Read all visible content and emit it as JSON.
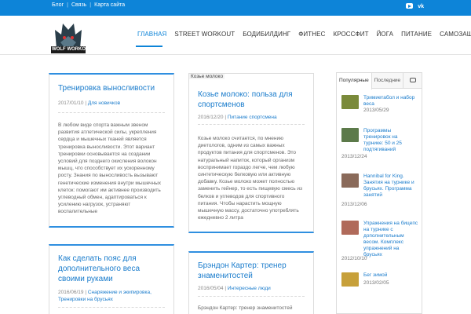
{
  "topbar": {
    "links": [
      "Блог",
      "Связь",
      "Карта сайта"
    ],
    "social": [
      "youtube-icon",
      "vk-icon"
    ],
    "vk_text": "vk"
  },
  "header": {
    "logo_text": "WOLF WORKOUT",
    "nav": [
      {
        "label": "ГЛАВНАЯ",
        "active": true
      },
      {
        "label": "STREET WORKOUT",
        "active": false
      },
      {
        "label": "БОДИБИЛДИНГ",
        "active": false
      },
      {
        "label": "ФИТНЕС",
        "active": false
      },
      {
        "label": "КРОССФИТ",
        "active": false
      },
      {
        "label": "ЙОГА",
        "active": false
      },
      {
        "label": "ПИТАНИЕ",
        "active": false
      },
      {
        "label": "САМОЗАЩИТА",
        "active": false
      }
    ]
  },
  "posts": [
    {
      "title": "Тренировка выносливости",
      "date": "2017/01/10",
      "category": "Для новичков",
      "excerpt": "В любом виде спорта важным звеном развития атлетической силы, укрепления сердца и мышечных тканей является тренировка выносливости. Этот вариант тренировки основывается на создании условий для позднего окисления волокон мышц, что способствует их ускоренному росту. Знания по выносливость вызывают генетические изменения внутри мышечных клеток: помогают им активнее производить углеводный обмен, адаптироваться к усилению нагрузок, устраняют воспалительные"
    },
    {
      "image_label": "Козье молоко",
      "title": "Козье молоко: польза для спортсменов",
      "date": "2016/12/20",
      "category": "Питание спортсмена",
      "excerpt": "Козье молоко считается, по мнению диетологов, одним из самых важных продуктов питания для спортсменов. Это натуральный напиток, который организм воспринимает гораздо легче, чем любую синтетическую белковую или активную добавку. Козье молоко может полностью заменить гейнер, то есть пищевую смесь из белков и углеводов для спортивного питания. Чтобы нарастить мощную мышечную массу, достаточно употреблять ежедневно 2 литра"
    },
    {
      "title": "Как сделать пояс для дополнительного веса своими руками",
      "date": "2016/06/19",
      "category": "Снаряжение и экипировка, Тренировки на брусьях"
    },
    {
      "title": "Брэндон Картер: тренер знаменитостей",
      "date": "2016/05/04",
      "category": "Интересные люди",
      "excerpt": "Брэндон Картер: тренер знаменитостей"
    }
  ],
  "sidebar": {
    "tabs": [
      "Популярные",
      "Последние"
    ],
    "comments_tab_icon": "comment-icon",
    "items": [
      {
        "title": "Тримиетабол и набор веса",
        "date": "2013/05/29",
        "thumb_color": "#7a8a3a"
      },
      {
        "title": "Программы тренировок на турнике: 50 и 25 подтягиваний",
        "date": "2013/12/24",
        "thumb_color": "#5c7a4a"
      },
      {
        "title": "Hannibal for King. Занятия на турнике и брусьях. Программа занятий",
        "date": "2013/12/06",
        "thumb_color": "#8a6a5a"
      },
      {
        "title": "Упражнения на бицепс на турнике с дополнительным весом. Комплекс упражнений на брусьях",
        "date": "2012/10/10",
        "thumb_color": "#b06a5a"
      },
      {
        "title": "Бег зимой",
        "date": "2013/02/05",
        "thumb_color": "#c7a03a"
      }
    ]
  },
  "colors": {
    "accent": "#0d84d8",
    "link": "#1a7ccc",
    "border": "#dcdcdc"
  }
}
